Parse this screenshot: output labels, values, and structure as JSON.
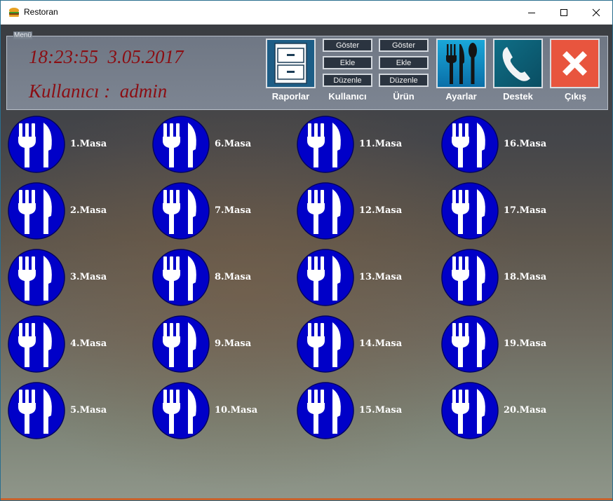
{
  "window": {
    "title": "Restoran"
  },
  "menu": {
    "legend": "Menü",
    "clock": "18:23:55  3.05.2017",
    "user": "Kullanıcı :  admin",
    "raporlar_label": "Raporlar",
    "kullanici": {
      "label": "Kullanıcı",
      "show": "Göster",
      "add": "Ekle",
      "edit": "Düzenle"
    },
    "urun": {
      "label": "Ürün",
      "show": "Göster",
      "add": "Ekle",
      "edit": "Düzenle"
    },
    "ayarlar_label": "Ayarlar",
    "destek_label": "Destek",
    "cikis_label": "Çıkış"
  },
  "tables": [
    "1.Masa",
    "2.Masa",
    "3.Masa",
    "4.Masa",
    "5.Masa",
    "6.Masa",
    "7.Masa",
    "8.Masa",
    "9.Masa",
    "10.Masa",
    "11.Masa",
    "12.Masa",
    "13.Masa",
    "14.Masa",
    "15.Masa",
    "16.Masa",
    "17.Masa",
    "18.Masa",
    "19.Masa",
    "20.Masa"
  ],
  "colors": {
    "table_icon_bg": "#0000c8",
    "clock_text": "#8b0d12",
    "exit_bg": "#e8553e"
  }
}
